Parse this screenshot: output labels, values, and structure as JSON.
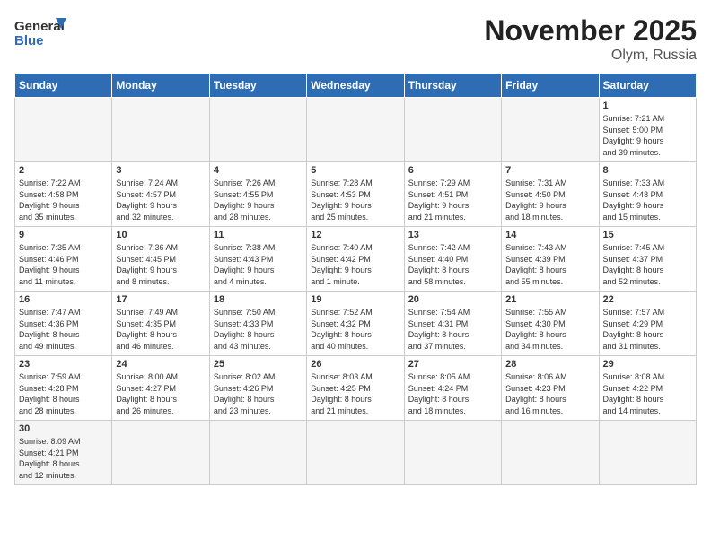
{
  "logo": {
    "line1": "General",
    "line2": "Blue"
  },
  "title": "November 2025",
  "subtitle": "Olym, Russia",
  "days_of_week": [
    "Sunday",
    "Monday",
    "Tuesday",
    "Wednesday",
    "Thursday",
    "Friday",
    "Saturday"
  ],
  "weeks": [
    [
      {
        "day": "",
        "info": ""
      },
      {
        "day": "",
        "info": ""
      },
      {
        "day": "",
        "info": ""
      },
      {
        "day": "",
        "info": ""
      },
      {
        "day": "",
        "info": ""
      },
      {
        "day": "",
        "info": ""
      },
      {
        "day": "1",
        "info": "Sunrise: 7:21 AM\nSunset: 5:00 PM\nDaylight: 9 hours\nand 39 minutes."
      }
    ],
    [
      {
        "day": "2",
        "info": "Sunrise: 7:22 AM\nSunset: 4:58 PM\nDaylight: 9 hours\nand 35 minutes."
      },
      {
        "day": "3",
        "info": "Sunrise: 7:24 AM\nSunset: 4:57 PM\nDaylight: 9 hours\nand 32 minutes."
      },
      {
        "day": "4",
        "info": "Sunrise: 7:26 AM\nSunset: 4:55 PM\nDaylight: 9 hours\nand 28 minutes."
      },
      {
        "day": "5",
        "info": "Sunrise: 7:28 AM\nSunset: 4:53 PM\nDaylight: 9 hours\nand 25 minutes."
      },
      {
        "day": "6",
        "info": "Sunrise: 7:29 AM\nSunset: 4:51 PM\nDaylight: 9 hours\nand 21 minutes."
      },
      {
        "day": "7",
        "info": "Sunrise: 7:31 AM\nSunset: 4:50 PM\nDaylight: 9 hours\nand 18 minutes."
      },
      {
        "day": "8",
        "info": "Sunrise: 7:33 AM\nSunset: 4:48 PM\nDaylight: 9 hours\nand 15 minutes."
      }
    ],
    [
      {
        "day": "9",
        "info": "Sunrise: 7:35 AM\nSunset: 4:46 PM\nDaylight: 9 hours\nand 11 minutes."
      },
      {
        "day": "10",
        "info": "Sunrise: 7:36 AM\nSunset: 4:45 PM\nDaylight: 9 hours\nand 8 minutes."
      },
      {
        "day": "11",
        "info": "Sunrise: 7:38 AM\nSunset: 4:43 PM\nDaylight: 9 hours\nand 4 minutes."
      },
      {
        "day": "12",
        "info": "Sunrise: 7:40 AM\nSunset: 4:42 PM\nDaylight: 9 hours\nand 1 minute."
      },
      {
        "day": "13",
        "info": "Sunrise: 7:42 AM\nSunset: 4:40 PM\nDaylight: 8 hours\nand 58 minutes."
      },
      {
        "day": "14",
        "info": "Sunrise: 7:43 AM\nSunset: 4:39 PM\nDaylight: 8 hours\nand 55 minutes."
      },
      {
        "day": "15",
        "info": "Sunrise: 7:45 AM\nSunset: 4:37 PM\nDaylight: 8 hours\nand 52 minutes."
      }
    ],
    [
      {
        "day": "16",
        "info": "Sunrise: 7:47 AM\nSunset: 4:36 PM\nDaylight: 8 hours\nand 49 minutes."
      },
      {
        "day": "17",
        "info": "Sunrise: 7:49 AM\nSunset: 4:35 PM\nDaylight: 8 hours\nand 46 minutes."
      },
      {
        "day": "18",
        "info": "Sunrise: 7:50 AM\nSunset: 4:33 PM\nDaylight: 8 hours\nand 43 minutes."
      },
      {
        "day": "19",
        "info": "Sunrise: 7:52 AM\nSunset: 4:32 PM\nDaylight: 8 hours\nand 40 minutes."
      },
      {
        "day": "20",
        "info": "Sunrise: 7:54 AM\nSunset: 4:31 PM\nDaylight: 8 hours\nand 37 minutes."
      },
      {
        "day": "21",
        "info": "Sunrise: 7:55 AM\nSunset: 4:30 PM\nDaylight: 8 hours\nand 34 minutes."
      },
      {
        "day": "22",
        "info": "Sunrise: 7:57 AM\nSunset: 4:29 PM\nDaylight: 8 hours\nand 31 minutes."
      }
    ],
    [
      {
        "day": "23",
        "info": "Sunrise: 7:59 AM\nSunset: 4:28 PM\nDaylight: 8 hours\nand 28 minutes."
      },
      {
        "day": "24",
        "info": "Sunrise: 8:00 AM\nSunset: 4:27 PM\nDaylight: 8 hours\nand 26 minutes."
      },
      {
        "day": "25",
        "info": "Sunrise: 8:02 AM\nSunset: 4:26 PM\nDaylight: 8 hours\nand 23 minutes."
      },
      {
        "day": "26",
        "info": "Sunrise: 8:03 AM\nSunset: 4:25 PM\nDaylight: 8 hours\nand 21 minutes."
      },
      {
        "day": "27",
        "info": "Sunrise: 8:05 AM\nSunset: 4:24 PM\nDaylight: 8 hours\nand 18 minutes."
      },
      {
        "day": "28",
        "info": "Sunrise: 8:06 AM\nSunset: 4:23 PM\nDaylight: 8 hours\nand 16 minutes."
      },
      {
        "day": "29",
        "info": "Sunrise: 8:08 AM\nSunset: 4:22 PM\nDaylight: 8 hours\nand 14 minutes."
      }
    ],
    [
      {
        "day": "30",
        "info": "Sunrise: 8:09 AM\nSunset: 4:21 PM\nDaylight: 8 hours\nand 12 minutes."
      },
      {
        "day": "",
        "info": ""
      },
      {
        "day": "",
        "info": ""
      },
      {
        "day": "",
        "info": ""
      },
      {
        "day": "",
        "info": ""
      },
      {
        "day": "",
        "info": ""
      },
      {
        "day": "",
        "info": ""
      }
    ]
  ]
}
